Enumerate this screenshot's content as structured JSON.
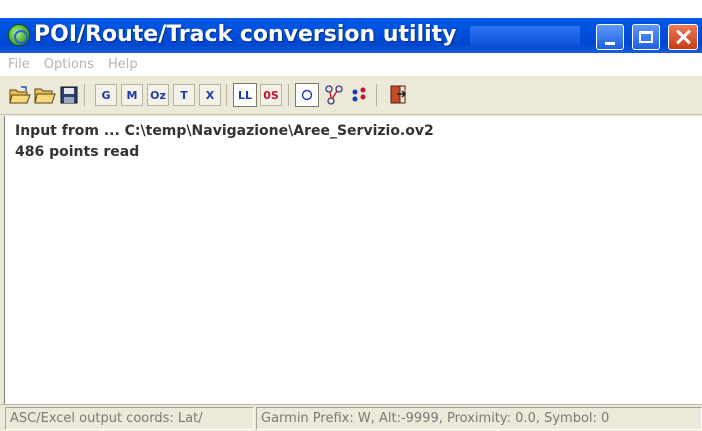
{
  "window": {
    "title": "POI/Route/Track conversion utility"
  },
  "menu": [
    "File",
    "Options",
    "Help"
  ],
  "toolbar": {
    "letters": [
      "G",
      "M",
      "Oz",
      "T",
      "X",
      "LL",
      "0S"
    ],
    "icons": [
      "open-icon",
      "open-folder-icon",
      "save-icon",
      "circle-icon",
      "route-icon",
      "waypoints-icon",
      "exit-icon"
    ]
  },
  "log": [
    "Input from ... C:\\temp\\Navigazione\\Aree_Servizio.ov2",
    "486 points read"
  ],
  "status": {
    "left": "ASC/Excel output coords: Lat/",
    "right": "Garmin Prefix: W, Alt:-9999, Proximity:   0.0, Symbol:  0"
  },
  "colors": {
    "titlebar": "#0053e3",
    "close_button": "#c63a16",
    "toolbar_letter": "#1a3ca8",
    "toolbar_letter_red": "#c8102e"
  }
}
